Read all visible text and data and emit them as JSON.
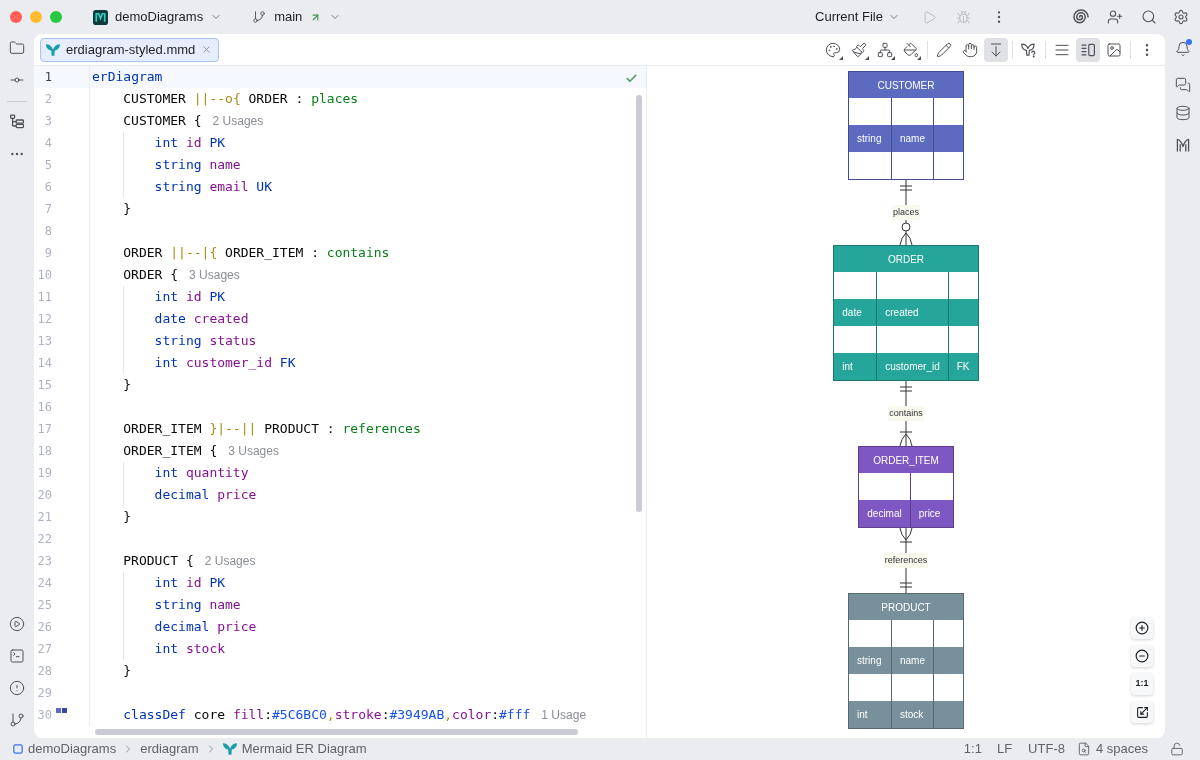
{
  "title_bar": {
    "project": "demoDiagrams",
    "branch": "main",
    "outgoing_commits": true,
    "run_configuration": "Current File",
    "run_disabled": true,
    "debug_disabled": true
  },
  "tabs": [
    {
      "label": "erdiagram-styled.mmd",
      "selected": true
    }
  ],
  "preview_toolbar": {
    "auto_scroll": true,
    "view_modes": [
      {
        "selected": false
      },
      {
        "selected": true
      },
      {
        "selected": false
      }
    ]
  },
  "editor": {
    "analysis_passed": true,
    "lines": [
      {
        "number": "1",
        "current": true,
        "tokens": [
          {
            "text": "erDiagram",
            "kind": "keyword"
          }
        ]
      },
      {
        "number": "2",
        "current": false,
        "tokens": [
          {
            "text": "    CUSTOMER ",
            "kind": "plain"
          },
          {
            "text": "||--o{",
            "kind": "operator"
          },
          {
            "text": " ORDER : ",
            "kind": "plain"
          },
          {
            "text": "places",
            "kind": "label"
          }
        ]
      },
      {
        "number": "3",
        "current": false,
        "tokens": [
          {
            "text": "    CUSTOMER {",
            "kind": "plain"
          }
        ],
        "hint": "2 Usages"
      },
      {
        "number": "4",
        "current": false,
        "tokens": [
          {
            "text": "        int ",
            "kind": "keyword"
          },
          {
            "text": "id ",
            "kind": "identifier"
          },
          {
            "text": "PK",
            "kind": "keyword"
          }
        ]
      },
      {
        "number": "5",
        "current": false,
        "tokens": [
          {
            "text": "        string ",
            "kind": "keyword"
          },
          {
            "text": "name",
            "kind": "identifier"
          }
        ]
      },
      {
        "number": "6",
        "current": false,
        "tokens": [
          {
            "text": "        string ",
            "kind": "keyword"
          },
          {
            "text": "email ",
            "kind": "identifier"
          },
          {
            "text": "UK",
            "kind": "keyword"
          }
        ]
      },
      {
        "number": "7",
        "current": false,
        "tokens": [
          {
            "text": "    }",
            "kind": "plain"
          }
        ]
      },
      {
        "number": "8",
        "current": false
      },
      {
        "number": "9",
        "current": false,
        "tokens": [
          {
            "text": "    ORDER ",
            "kind": "plain"
          },
          {
            "text": "||--|{",
            "kind": "operator"
          },
          {
            "text": " ORDER_ITEM : ",
            "kind": "plain"
          },
          {
            "text": "contains",
            "kind": "label"
          }
        ]
      },
      {
        "number": "10",
        "current": false,
        "tokens": [
          {
            "text": "    ORDER {",
            "kind": "plain"
          }
        ],
        "hint": "3 Usages"
      },
      {
        "number": "11",
        "current": false,
        "tokens": [
          {
            "text": "        int ",
            "kind": "keyword"
          },
          {
            "text": "id ",
            "kind": "identifier"
          },
          {
            "text": "PK",
            "kind": "keyword"
          }
        ]
      },
      {
        "number": "12",
        "current": false,
        "tokens": [
          {
            "text": "        date ",
            "kind": "keyword"
          },
          {
            "text": "created",
            "kind": "identifier"
          }
        ]
      },
      {
        "number": "13",
        "current": false,
        "tokens": [
          {
            "text": "        string ",
            "kind": "keyword"
          },
          {
            "text": "status",
            "kind": "identifier"
          }
        ]
      },
      {
        "number": "14",
        "current": false,
        "tokens": [
          {
            "text": "        int ",
            "kind": "keyword"
          },
          {
            "text": "customer_id ",
            "kind": "identifier"
          },
          {
            "text": "FK",
            "kind": "keyword"
          }
        ]
      },
      {
        "number": "15",
        "current": false,
        "tokens": [
          {
            "text": "    }",
            "kind": "plain"
          }
        ]
      },
      {
        "number": "16",
        "current": false
      },
      {
        "number": "17",
        "current": false,
        "tokens": [
          {
            "text": "    ORDER_ITEM ",
            "kind": "plain"
          },
          {
            "text": "}|--||",
            "kind": "operator"
          },
          {
            "text": " PRODUCT : ",
            "kind": "plain"
          },
          {
            "text": "references",
            "kind": "label"
          }
        ]
      },
      {
        "number": "18",
        "current": false,
        "tokens": [
          {
            "text": "    ORDER_ITEM {",
            "kind": "plain"
          }
        ],
        "hint": "3 Usages"
      },
      {
        "number": "19",
        "current": false,
        "tokens": [
          {
            "text": "        int ",
            "kind": "keyword"
          },
          {
            "text": "quantity",
            "kind": "identifier"
          }
        ]
      },
      {
        "number": "20",
        "current": false,
        "tokens": [
          {
            "text": "        decimal ",
            "kind": "keyword"
          },
          {
            "text": "price",
            "kind": "identifier"
          }
        ]
      },
      {
        "number": "21",
        "current": false,
        "tokens": [
          {
            "text": "    }",
            "kind": "plain"
          }
        ]
      },
      {
        "number": "22",
        "current": false
      },
      {
        "number": "23",
        "current": false,
        "tokens": [
          {
            "text": "    PRODUCT {",
            "kind": "plain"
          }
        ],
        "hint": "2 Usages"
      },
      {
        "number": "24",
        "current": false,
        "tokens": [
          {
            "text": "        int ",
            "kind": "keyword"
          },
          {
            "text": "id ",
            "kind": "identifier"
          },
          {
            "text": "PK",
            "kind": "keyword"
          }
        ]
      },
      {
        "number": "25",
        "current": false,
        "tokens": [
          {
            "text": "        string ",
            "kind": "keyword"
          },
          {
            "text": "name",
            "kind": "identifier"
          }
        ]
      },
      {
        "number": "26",
        "current": false,
        "tokens": [
          {
            "text": "        decimal ",
            "kind": "keyword"
          },
          {
            "text": "price",
            "kind": "identifier"
          }
        ]
      },
      {
        "number": "27",
        "current": false,
        "tokens": [
          {
            "text": "        int ",
            "kind": "keyword"
          },
          {
            "text": "stock",
            "kind": "identifier"
          }
        ]
      },
      {
        "number": "28",
        "current": false,
        "tokens": [
          {
            "text": "    }",
            "kind": "plain"
          }
        ]
      },
      {
        "number": "29",
        "current": false
      },
      {
        "number": "30",
        "current": false,
        "swatches": [
          {
            "color": "#5c6bc0"
          },
          {
            "color": "#3949ab"
          }
        ],
        "tokens": [
          {
            "text": "    classDef ",
            "kind": "keyword"
          },
          {
            "text": "core ",
            "kind": "plain"
          },
          {
            "text": "fill",
            "kind": "identifier"
          },
          {
            "text": ":",
            "kind": "plain"
          },
          {
            "text": "#5C6BC0",
            "kind": "value"
          },
          {
            "text": ",",
            "kind": "operator"
          },
          {
            "text": "stroke",
            "kind": "identifier"
          },
          {
            "text": ":",
            "kind": "plain"
          },
          {
            "text": "#3949AB",
            "kind": "value"
          },
          {
            "text": ",",
            "kind": "operator"
          },
          {
            "text": "color",
            "kind": "identifier"
          },
          {
            "text": ":",
            "kind": "plain"
          },
          {
            "text": "#fff",
            "kind": "value"
          }
        ],
        "hint": "1 Usage"
      }
    ]
  },
  "diagram": {
    "entities": [
      {
        "name": "CUSTOMER",
        "color": "#5c6bc0",
        "key_column": true,
        "rows": [
          {
            "shaded": false
          },
          {
            "shaded": true,
            "cells": [
              "string",
              "name"
            ]
          },
          {
            "shaded": false
          }
        ]
      },
      {
        "name": "ORDER",
        "color": "#26a69a",
        "key_column": true,
        "rows": [
          {
            "shaded": false
          },
          {
            "shaded": true,
            "cells": [
              "date",
              "created"
            ]
          },
          {
            "shaded": false
          },
          {
            "shaded": true,
            "cells": [
              "int",
              "customer_id",
              "FK"
            ]
          }
        ]
      },
      {
        "name": "ORDER_ITEM",
        "color": "#7e57c2",
        "key_column": false,
        "rows": [
          {
            "shaded": false
          },
          {
            "shaded": true,
            "cells": [
              "decimal",
              "price"
            ]
          }
        ]
      },
      {
        "name": "PRODUCT",
        "color": "#78909c",
        "key_column": true,
        "rows": [
          {
            "shaded": false
          },
          {
            "shaded": true,
            "cells": [
              "string",
              "name"
            ]
          },
          {
            "shaded": false
          },
          {
            "shaded": true,
            "cells": [
              "int",
              "stock"
            ]
          }
        ]
      }
    ],
    "relationships": [
      {
        "label": "places",
        "from_many": false,
        "from_optional": false,
        "to_many": true,
        "to_optional": true
      },
      {
        "label": "contains",
        "from_many": false,
        "from_optional": false,
        "to_many": true,
        "to_optional": false
      },
      {
        "label": "references",
        "from_many": true,
        "from_optional": false,
        "to_many": false,
        "to_optional": false
      }
    ]
  },
  "zoom_controls": {
    "actual_size": "1:1"
  },
  "notifications": {
    "unread": true
  },
  "status_bar": {
    "breadcrumbs": [
      {
        "label": "demoDiagrams",
        "kind": "module"
      },
      {
        "label": "erdiagram",
        "kind": "folder"
      },
      {
        "label": "Mermaid ER Diagram",
        "kind": "mermaid"
      }
    ],
    "position": "1:1",
    "line_separator": "LF",
    "encoding": "UTF-8",
    "indent": "4 spaces",
    "read_only": false
  }
}
